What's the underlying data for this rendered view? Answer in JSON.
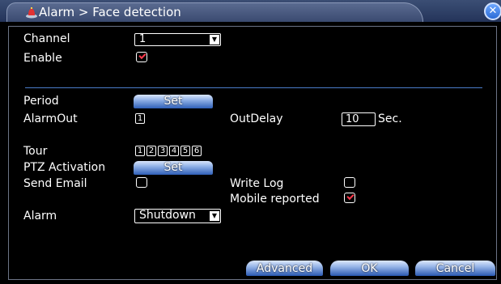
{
  "window": {
    "title": "Alarm > Face detection",
    "close_icon": "close-icon",
    "title_icon": "alarm-icon"
  },
  "form": {
    "channel_label": "Channel",
    "channel_value": "1",
    "enable_label": "Enable",
    "enable_checked": true,
    "period_label": "Period",
    "period_button": "Set",
    "alarmout_label": "AlarmOut",
    "alarmout_channels": [
      "1"
    ],
    "outdelay_label": "OutDelay",
    "outdelay_value": "10",
    "outdelay_unit": "Sec.",
    "tour_label": "Tour",
    "tour_channels": [
      "1",
      "2",
      "3",
      "4",
      "5",
      "6"
    ],
    "ptz_label": "PTZ Activation",
    "ptz_button": "Set",
    "send_email_label": "Send Email",
    "send_email_checked": false,
    "write_log_label": "Write Log",
    "write_log_checked": false,
    "mobile_label": "Mobile reported",
    "mobile_checked": true,
    "alarm_label": "Alarm",
    "alarm_value": "Shutdown"
  },
  "buttons": {
    "advanced": "Advanced",
    "ok": "OK",
    "cancel": "Cancel"
  },
  "colors": {
    "accent": "#2f5fb8",
    "check": "#ff3b4e",
    "divider": "#4a7cc8"
  }
}
